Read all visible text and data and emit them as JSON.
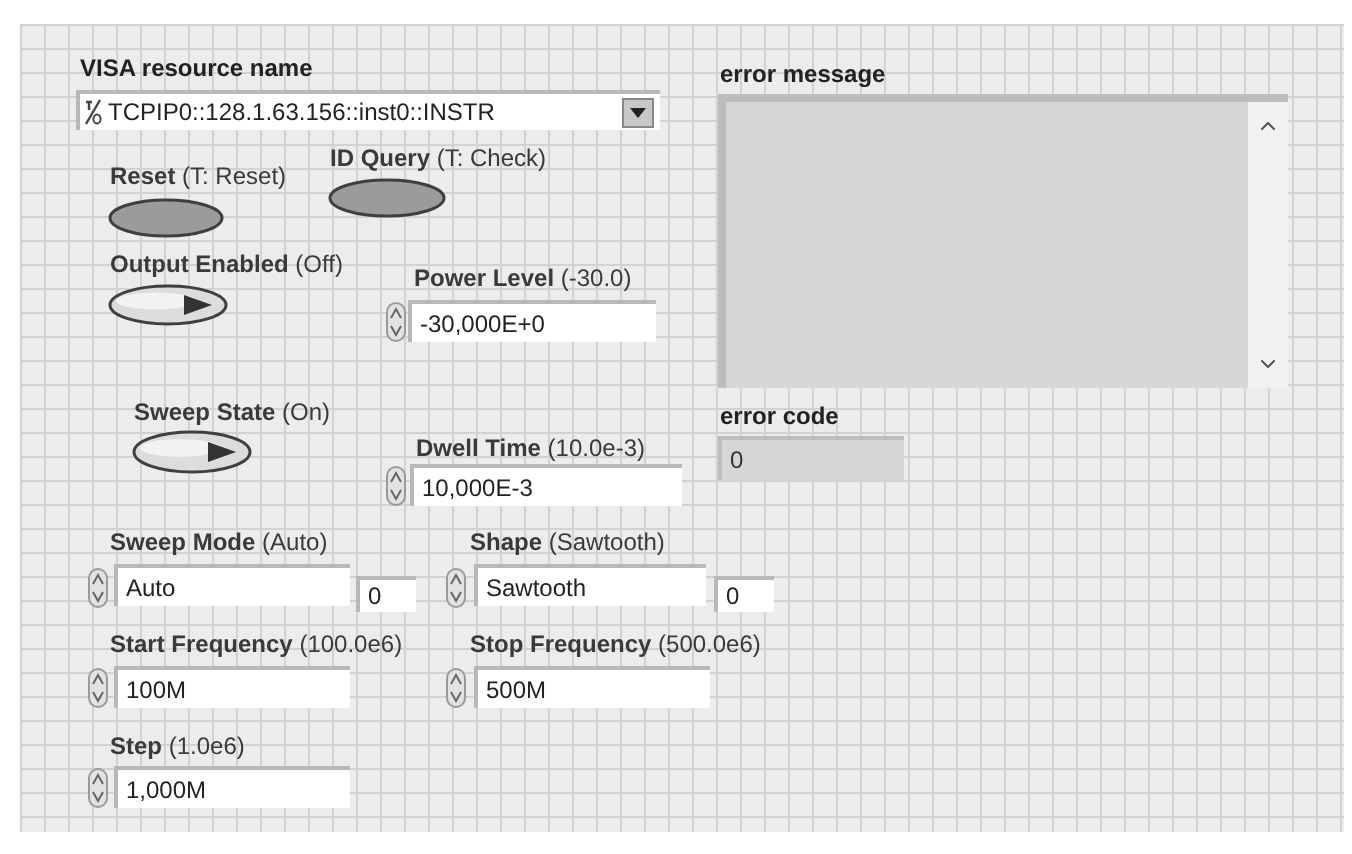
{
  "visa_resource": {
    "label": "VISA resource name",
    "value": "TCPIP0::128.1.63.156::inst0::INSTR"
  },
  "reset": {
    "label": "**Reset** (T: Reset)"
  },
  "id_query": {
    "label": "**ID Query** (T: Check)"
  },
  "output_enabled": {
    "label": "**Output Enabled** (Off)",
    "on": true
  },
  "power_level": {
    "label": "**Power Level** (-30.0)",
    "value": "-30,000E+0"
  },
  "error_message": {
    "label": "error message"
  },
  "sweep_state": {
    "label": "**Sweep State** (On)",
    "on": true
  },
  "dwell_time": {
    "label": "**Dwell Time** (10.0e-3)",
    "value": "10,000E-3"
  },
  "error_code": {
    "label": "error code",
    "value": "0"
  },
  "sweep_mode": {
    "label": "**Sweep Mode** (Auto)",
    "value": "Auto",
    "index": "0"
  },
  "shape": {
    "label": "**Shape** (Sawtooth)",
    "value": "Sawtooth",
    "index": "0"
  },
  "start_frequency": {
    "label": "**Start Frequency** (100.0e6)",
    "value": "100M"
  },
  "stop_frequency": {
    "label": "**Stop Frequency** (500.0e6)",
    "value": "500M"
  },
  "step": {
    "label": "**Step** (1.0e6)",
    "value": "1,000M"
  }
}
